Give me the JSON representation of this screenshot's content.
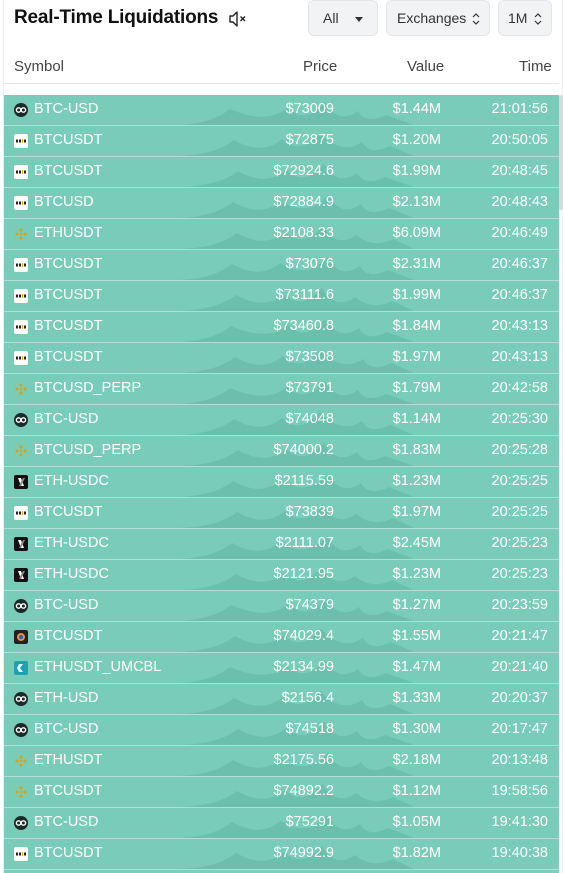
{
  "header": {
    "title": "Real-Time Liquidations",
    "filter_label": "All",
    "exchanges_label": "Exchanges",
    "timeframe_label": "1M"
  },
  "columns": {
    "symbol": "Symbol",
    "price": "Price",
    "value": "Value",
    "time": "Time"
  },
  "colors": {
    "row_bg": "#79cdb8",
    "row_wave": "#5eb79f",
    "text": "#ffffff"
  },
  "rows": [
    {
      "exchange": "okx-icon",
      "symbol": "BTC-USD",
      "price": "$73009",
      "value": "$1.44M",
      "time": "21:01:56"
    },
    {
      "exchange": "bybit-icon",
      "symbol": "BTCUSDT",
      "price": "$72875",
      "value": "$1.20M",
      "time": "20:50:05"
    },
    {
      "exchange": "bybit-icon",
      "symbol": "BTCUSDT",
      "price": "$72924.6",
      "value": "$1.99M",
      "time": "20:48:45"
    },
    {
      "exchange": "bybit-icon",
      "symbol": "BTCUSD",
      "price": "$72884.9",
      "value": "$2.13M",
      "time": "20:48:43"
    },
    {
      "exchange": "binance-icon",
      "symbol": "ETHUSDT",
      "price": "$2108.33",
      "value": "$6.09M",
      "time": "20:46:49"
    },
    {
      "exchange": "bybit-icon",
      "symbol": "BTCUSDT",
      "price": "$73076",
      "value": "$2.31M",
      "time": "20:46:37"
    },
    {
      "exchange": "bybit-icon",
      "symbol": "BTCUSDT",
      "price": "$73111.6",
      "value": "$1.99M",
      "time": "20:46:37"
    },
    {
      "exchange": "bybit-icon",
      "symbol": "BTCUSDT",
      "price": "$73460.8",
      "value": "$1.84M",
      "time": "20:43:13"
    },
    {
      "exchange": "bybit-icon",
      "symbol": "BTCUSDT",
      "price": "$73508",
      "value": "$1.97M",
      "time": "20:43:13"
    },
    {
      "exchange": "binance-icon",
      "symbol": "BTCUSD_PERP",
      "price": "$73791",
      "value": "$1.79M",
      "time": "20:42:58"
    },
    {
      "exchange": "okx-icon",
      "symbol": "BTC-USD",
      "price": "$74048",
      "value": "$1.14M",
      "time": "20:25:30"
    },
    {
      "exchange": "binance-icon",
      "symbol": "BTCUSD_PERP",
      "price": "$74000.2",
      "value": "$1.83M",
      "time": "20:25:28"
    },
    {
      "exchange": "dydx-icon",
      "symbol": "ETH-USDC",
      "price": "$2115.59",
      "value": "$1.23M",
      "time": "20:25:25"
    },
    {
      "exchange": "bybit-icon",
      "symbol": "BTCUSDT",
      "price": "$73839",
      "value": "$1.97M",
      "time": "20:25:25"
    },
    {
      "exchange": "dydx-icon",
      "symbol": "ETH-USDC",
      "price": "$2111.07",
      "value": "$2.45M",
      "time": "20:25:23"
    },
    {
      "exchange": "dydx-icon",
      "symbol": "ETH-USDC",
      "price": "$2121.95",
      "value": "$1.23M",
      "time": "20:25:23"
    },
    {
      "exchange": "okx-icon",
      "symbol": "BTC-USD",
      "price": "$74379",
      "value": "$1.27M",
      "time": "20:23:59"
    },
    {
      "exchange": "gate-icon",
      "symbol": "BTCUSDT",
      "price": "$74029.4",
      "value": "$1.55M",
      "time": "20:21:47"
    },
    {
      "exchange": "bitget-icon",
      "symbol": "ETHUSDT_UMCBL",
      "price": "$2134.99",
      "value": "$1.47M",
      "time": "20:21:40"
    },
    {
      "exchange": "okx-icon",
      "symbol": "ETH-USD",
      "price": "$2156.4",
      "value": "$1.33M",
      "time": "20:20:37"
    },
    {
      "exchange": "okx-icon",
      "symbol": "BTC-USD",
      "price": "$74518",
      "value": "$1.30M",
      "time": "20:17:47"
    },
    {
      "exchange": "binance-icon",
      "symbol": "ETHUSDT",
      "price": "$2175.56",
      "value": "$2.18M",
      "time": "20:13:48"
    },
    {
      "exchange": "binance-icon",
      "symbol": "BTCUSDT",
      "price": "$74892.2",
      "value": "$1.12M",
      "time": "19:58:56"
    },
    {
      "exchange": "okx-icon",
      "symbol": "BTC-USD",
      "price": "$75291",
      "value": "$1.05M",
      "time": "19:41:30"
    },
    {
      "exchange": "bybit-icon",
      "symbol": "BTCUSDT",
      "price": "$74992.9",
      "value": "$1.82M",
      "time": "19:40:38"
    }
  ]
}
